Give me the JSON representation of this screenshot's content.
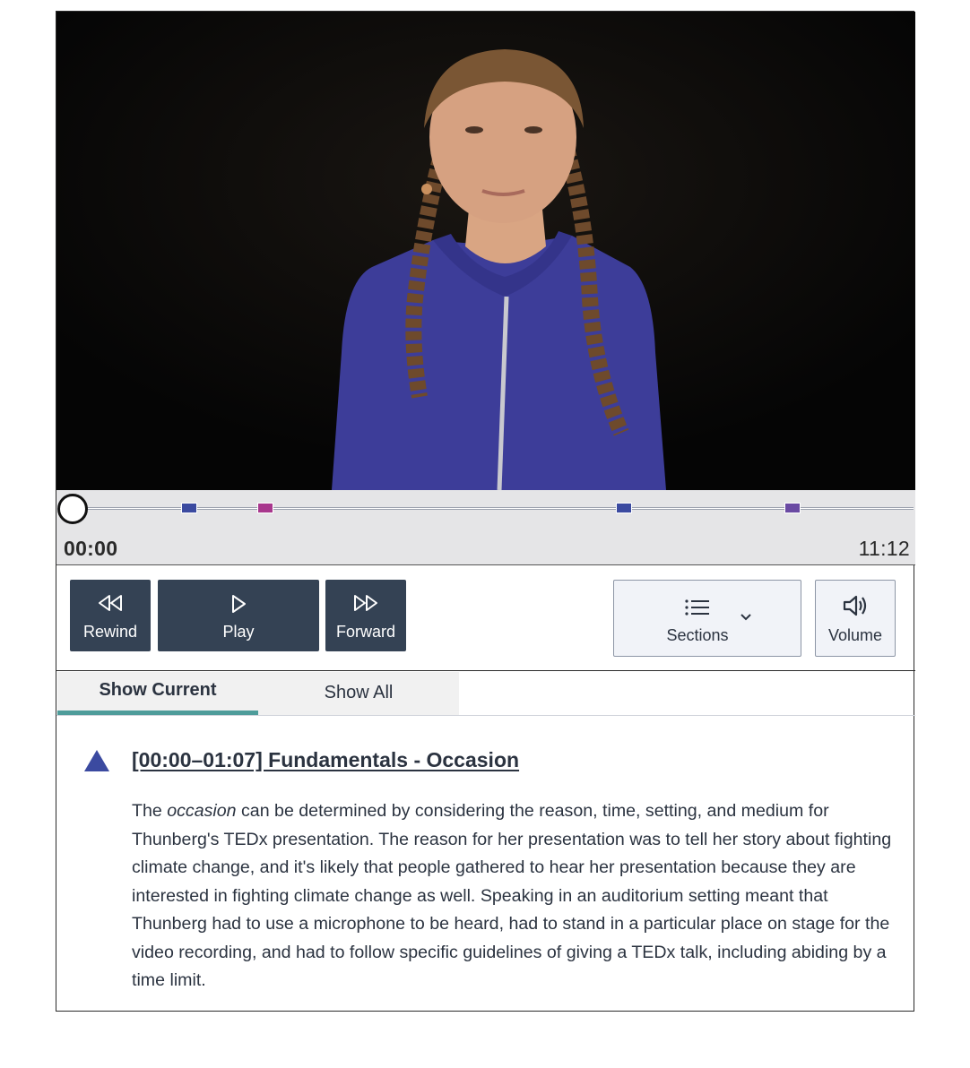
{
  "player": {
    "time_current": "00:00",
    "time_total": "11:12",
    "progress": 0
  },
  "markers": [
    {
      "time_fraction": 0.139,
      "color": "#3b4aa0"
    },
    {
      "time_fraction": 0.229,
      "color": "#a8378d"
    },
    {
      "time_fraction": 0.656,
      "color": "#3b4aa0"
    },
    {
      "time_fraction": 0.856,
      "color": "#6a4aa3"
    }
  ],
  "controls": {
    "rewind_label": "Rewind",
    "play_label": "Play",
    "forward_label": "Forward",
    "sections_label": "Sections",
    "volume_label": "Volume"
  },
  "tabs": {
    "current_label": "Show Current",
    "all_label": "Show All"
  },
  "section": {
    "title": "[00:00–01:07] Fundamentals - Occasion",
    "marker_color": "#3b4aa0",
    "body_intro": "The ",
    "body_emphasis": "occasion",
    "body_rest": " can be determined by considering the reason, time, setting, and medium for Thunberg's TEDx presentation. The reason for her presentation was to tell her story about fighting climate change, and it's likely that people gathered to hear her presentation because they are interested in fighting climate change as well. Speaking in an auditorium setting meant that Thunberg had to use a microphone to be heard, had to stand in a particular place on stage for the video recording, and had to follow specific guidelines of giving a TEDx talk, including abiding by a time limit."
  },
  "colors": {
    "button_dark": "#344254",
    "tab_underline": "#4e9c9a",
    "timeline_bg": "#e5e5e7"
  },
  "icons": {
    "rewind": "rewind-icon",
    "play": "play-icon",
    "forward": "forward-icon",
    "sections": "list-icon",
    "sections_caret": "chevron-down-icon",
    "volume": "speaker-icon",
    "section_marker": "triangle-icon"
  }
}
